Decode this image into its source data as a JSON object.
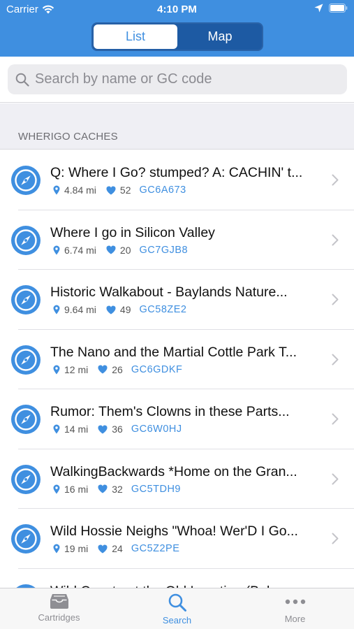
{
  "status_bar": {
    "carrier": "Carrier",
    "time": "4:10 PM"
  },
  "header": {
    "segments": [
      {
        "label": "List",
        "selected": true
      },
      {
        "label": "Map",
        "selected": false
      }
    ]
  },
  "search": {
    "placeholder": "Search by name or GC code",
    "value": ""
  },
  "section": {
    "title": "WHERIGO CACHES"
  },
  "colors": {
    "accent": "#3f8fe0",
    "header": "#3f8fe0",
    "segment_bg": "#1d5aa3"
  },
  "caches": [
    {
      "title": "Q: Where I Go? stumped? A: CACHIN' t...",
      "distance": "4.84 mi",
      "favorites": "52",
      "code": "GC6A673"
    },
    {
      "title": "Where I go in Silicon Valley",
      "distance": "6.74 mi",
      "favorites": "20",
      "code": "GC7GJB8"
    },
    {
      "title": "Historic Walkabout - Baylands Nature...",
      "distance": "9.64 mi",
      "favorites": "49",
      "code": "GC58ZE2"
    },
    {
      "title": "The Nano and the Martial Cottle Park T...",
      "distance": "12 mi",
      "favorites": "26",
      "code": "GC6GDKF"
    },
    {
      "title": "Rumor:  Them's Clowns in these Parts...",
      "distance": "14 mi",
      "favorites": "36",
      "code": "GC6W0HJ"
    },
    {
      "title": "WalkingBackwards *Home on the Gran...",
      "distance": "16 mi",
      "favorites": "32",
      "code": "GC5TDH9"
    },
    {
      "title": "Wild Hossie Neighs \"Whoa! Wer'D I Go...",
      "distance": "19 mi",
      "favorites": "24",
      "code": "GC5Z2PE"
    },
    {
      "title": "Wild Coyote at the Old Location (Bel...",
      "distance": "",
      "favorites": "",
      "code": ""
    }
  ],
  "tabbar": {
    "tabs": [
      {
        "label": "Cartridges",
        "icon": "tray-icon",
        "selected": false
      },
      {
        "label": "Search",
        "icon": "search-icon",
        "selected": true
      },
      {
        "label": "More",
        "icon": "ellipsis-icon",
        "selected": false
      }
    ]
  }
}
